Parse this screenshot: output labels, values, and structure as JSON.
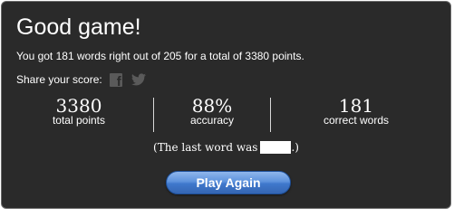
{
  "dialog": {
    "title": "Good game!",
    "summary": "You got 181 words right out of 205 for a total of 3380 points.",
    "share_label": "Share your score:",
    "facebook_glyph": "f",
    "icons": [
      "facebook-icon",
      "twitter-icon"
    ]
  },
  "stats": [
    {
      "value": "3380",
      "label": "total points"
    },
    {
      "value": "88%",
      "label": "accuracy"
    },
    {
      "value": "181",
      "label": "correct words"
    }
  ],
  "last_word": {
    "prefix": "(The last word was",
    "suffix": ".)"
  },
  "play_button": {
    "label": "Play Again",
    "accent_color": "#4a82d6"
  },
  "colors": {
    "background": "#2a2a2a",
    "text": "#ffffff",
    "icon_gray": "#5a5a5a"
  }
}
